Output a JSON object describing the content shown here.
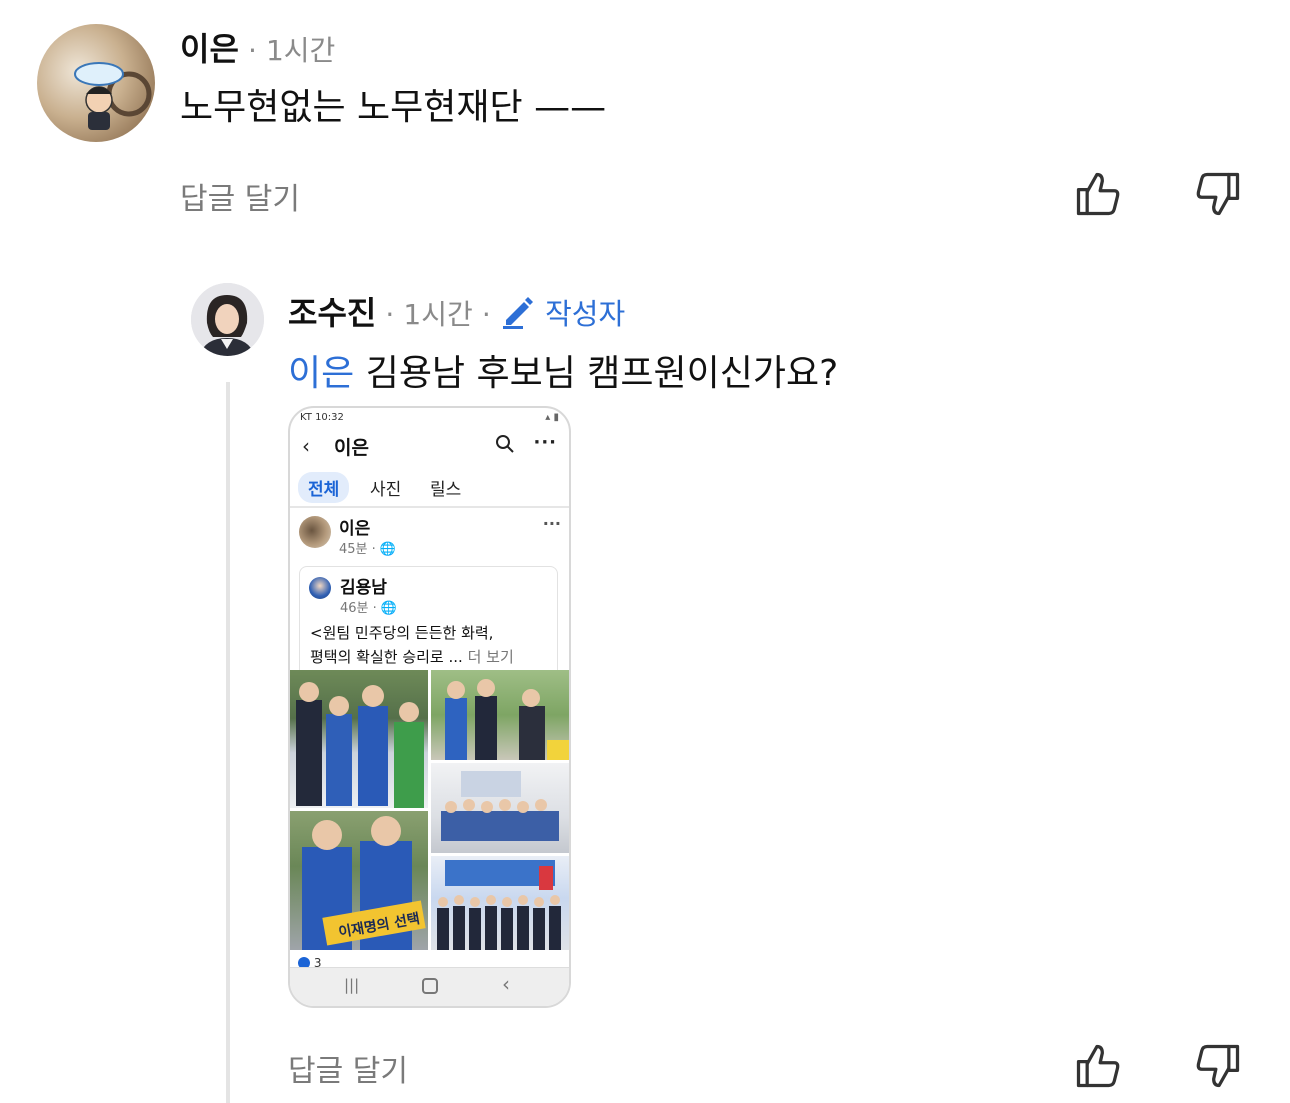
{
  "comment": {
    "author": "이은",
    "separator": "·",
    "time": "1시간",
    "text": "노무현없는 노무현재단 ——",
    "reply_label": "답글 달기"
  },
  "reply": {
    "author": "조수진",
    "separator": "·",
    "time": "1시간",
    "separator2": "·",
    "author_badge": "작성자",
    "mention": "이은",
    "text": " 김용남 후보님 캠프원이신가요?",
    "reply_label": "답글 달기"
  },
  "embedded_screenshot": {
    "status_time": "KT 10:32",
    "page_title": "이은",
    "tabs": [
      "전체",
      "사진",
      "릴스"
    ],
    "post": {
      "author": "이은",
      "time": "45분 · 🌐",
      "shared": {
        "author": "김용남",
        "time": "46분 · 🌐",
        "line1": "<원팀 민주당의 든든한 화력,",
        "line2": "평택의 확실한 승리로 ...",
        "see_more": " 더 보기"
      }
    },
    "photo_banner_text": "이재명의 선택",
    "like_count": "3"
  },
  "colors": {
    "mention": "#2d6fd6",
    "meta_gray": "#8a8a8a",
    "thread_line": "#e4e4e4"
  }
}
